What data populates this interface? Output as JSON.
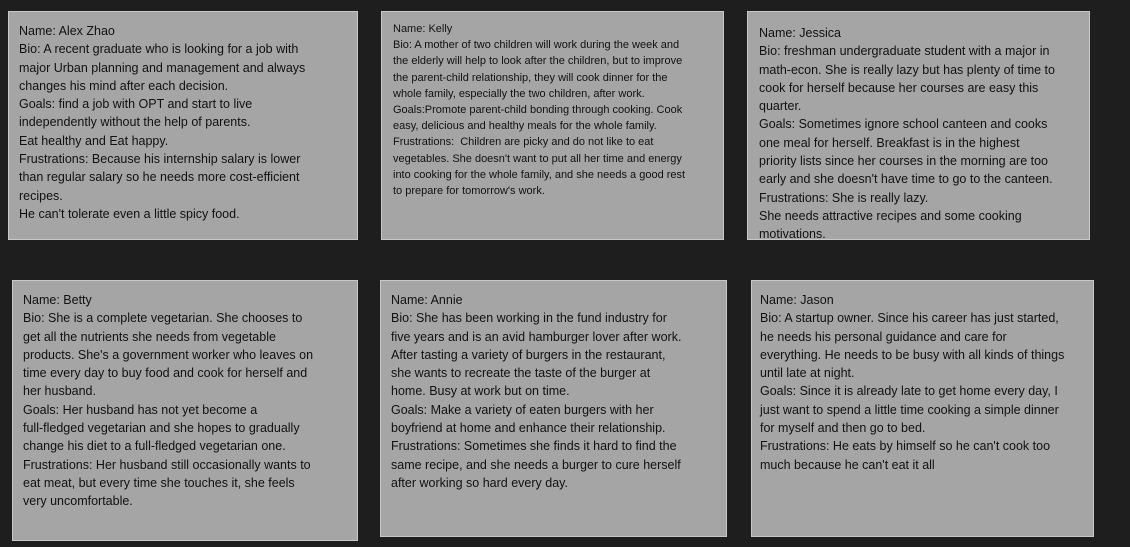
{
  "cards": [
    {
      "id": "alex-zhao",
      "lines": [
        "Name: Alex Zhao",
        "Bio: A recent graduate who is looking for a job with",
        "major Urban planning and management and always",
        "changes his mind after each decision.",
        "Goals: find a job with OPT and start to live",
        "independently without the help of parents.",
        "Eat healthy and Eat happy.",
        "Frustrations: Because his internship salary is lower",
        "than regular salary so he needs more cost-efficient",
        "recipes.",
        "He can't tolerate even a little spicy food."
      ]
    },
    {
      "id": "kelly",
      "lines": [
        "Name: Kelly",
        "Bio: A mother of two children will work during the week and",
        "the elderly will help to look after the children, but to improve",
        "the parent-child relationship, they will cook dinner for the",
        "whole family, especially the two children, after work.",
        "Goals:Promote parent-child bonding through cooking. Cook",
        "easy, delicious and healthy meals for the whole family.",
        "Frustrations:  Children are picky and do not like to eat",
        "vegetables. She doesn't want to put all her time and energy",
        "into cooking for the whole family, and she needs a good rest",
        "to prepare for tomorrow's work."
      ]
    },
    {
      "id": "jessica",
      "lines": [
        "Name: Jessica",
        "Bio: freshman undergraduate student with a major in",
        "math-econ. She is really lazy but has plenty of time to",
        "cook for herself because her courses are easy this",
        "quarter.",
        "Goals: Sometimes ignore school canteen and cooks",
        "one meal for herself. Breakfast is in the highest",
        "priority lists since her courses in the morning are too",
        "early and she doesn't have time to go to the canteen.",
        "Frustrations: She is really lazy.",
        "She needs attractive recipes and some cooking",
        "motivations."
      ]
    },
    {
      "id": "betty",
      "lines": [
        "Name: Betty",
        "Bio: She is a complete vegetarian. She chooses to",
        "get all the nutrients she needs from vegetable",
        "products. She's a government worker who leaves on",
        "time every day to buy food and cook for herself and",
        "her husband.",
        "Goals: Her husband has not yet become a",
        "full-fledged vegetarian and she hopes to gradually",
        "change his diet to a full-fledged vegetarian one.",
        "Frustrations: Her husband still occasionally wants to",
        "eat meat, but every time she touches it, she feels",
        "very uncomfortable."
      ]
    },
    {
      "id": "annie",
      "lines": [
        "Name: Annie",
        "Bio: She has been working in the fund industry for",
        "five years and is an avid hamburger lover after work.",
        "After tasting a variety of burgers in the restaurant,",
        "she wants to recreate the taste of the burger at",
        "home. Busy at work but on time.",
        "Goals: Make a variety of eaten burgers with her",
        "boyfriend at home and enhance their relationship.",
        "Frustrations: Sometimes she finds it hard to find the",
        "same recipe, and she needs a burger to cure herself",
        "after working so hard every day."
      ]
    },
    {
      "id": "jason",
      "lines": [
        "Name: Jason",
        "Bio: A startup owner. Since his career has just started,",
        "he needs his personal guidance and care for",
        "everything. He needs to be busy with all kinds of things",
        "until late at night.",
        "Goals: Since it is already late to get home every day, I",
        "just want to spend a little time cooking a simple dinner",
        "for myself and then go to bed.",
        "Frustrations: He eats by himself so he can't cook too",
        "much because he can't eat it all"
      ]
    }
  ]
}
